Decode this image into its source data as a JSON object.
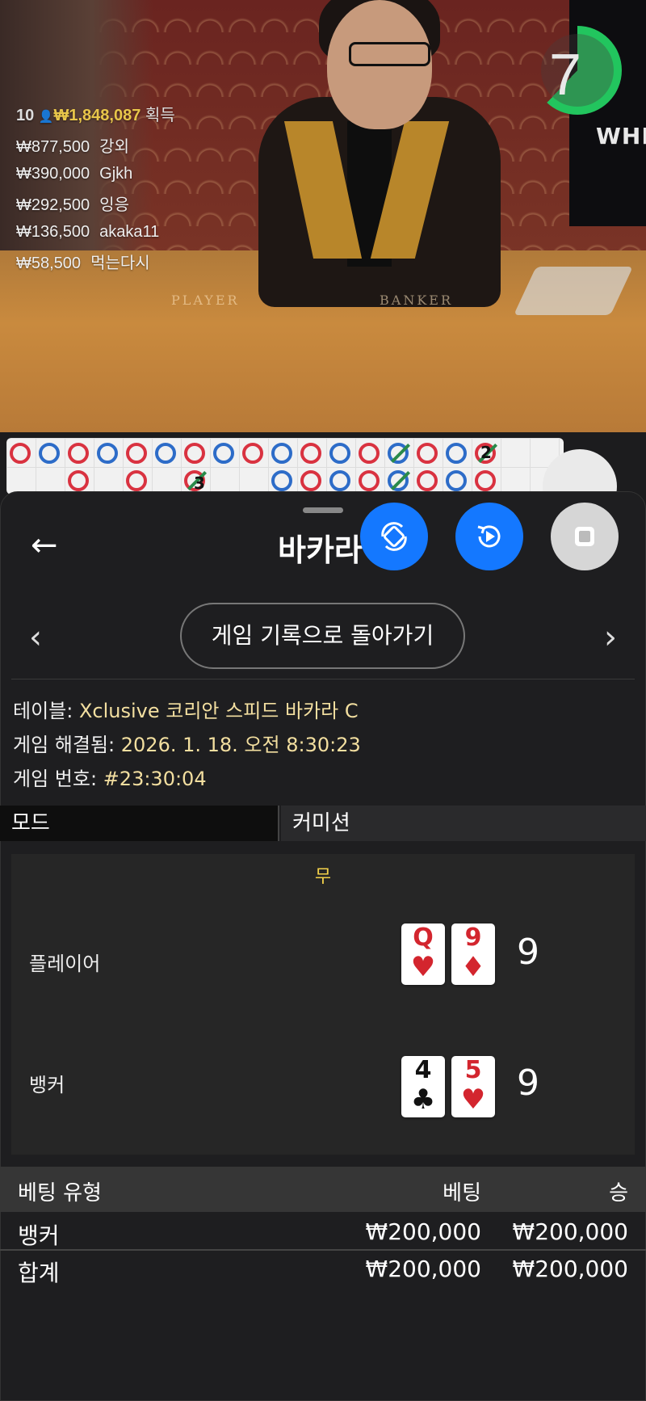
{
  "video": {
    "table_labels": [
      "PLAYER",
      "BANKER"
    ],
    "screen_text": "WHITE"
  },
  "timer": {
    "seconds": "7",
    "progress": 0.62,
    "color": "#22c55e"
  },
  "winners": {
    "count": "10",
    "total": "₩1,848,087",
    "total_label": "획득",
    "list": [
      {
        "amount": "₩877,500",
        "name": "강외"
      },
      {
        "amount": "₩390,000",
        "name": "Gjkh"
      },
      {
        "amount": "₩292,500",
        "name": "잉응"
      },
      {
        "amount": "₩136,500",
        "name": "akaka11"
      },
      {
        "amount": "₩58,500",
        "name": "먹는다시"
      }
    ]
  },
  "road": {
    "colors": {
      "banker": "#d93240",
      "player": "#2d6cc8",
      "tie": "#2a8a4a"
    },
    "numbers": [
      "3",
      "2"
    ]
  },
  "panel": {
    "title": "바카라",
    "back_icon": "arrow-left-icon",
    "buttons": [
      "rotate-icon",
      "replay-icon",
      "stop-icon"
    ],
    "return_label": "게임 기록으로 돌아가기"
  },
  "info": {
    "table_label": "테이블:",
    "table_value": "Xclusive 코리안 스피드 바카라 C",
    "resolved_label": "게임 해결됨:",
    "resolved_value": "2026. 1. 18. 오전 8:30:23",
    "number_label": "게임 번호:",
    "number_value": "#23:30:04"
  },
  "tabs": {
    "mode": "모드",
    "commission": "커미션"
  },
  "result": {
    "outcome": "무",
    "player": {
      "label": "플레이어",
      "cards": [
        {
          "rank": "Q",
          "suit": "♥",
          "color": "red"
        },
        {
          "rank": "9",
          "suit": "♦",
          "color": "red"
        }
      ],
      "score": "9"
    },
    "banker": {
      "label": "뱅커",
      "cards": [
        {
          "rank": "4",
          "suit": "♣",
          "color": "black"
        },
        {
          "rank": "5",
          "suit": "♥",
          "color": "red"
        }
      ],
      "score": "9"
    }
  },
  "bets": {
    "headers": {
      "type": "베팅 유형",
      "bet": "베팅",
      "win": "승"
    },
    "rows": [
      {
        "type": "뱅커",
        "bet": "₩200,000",
        "win": "₩200,000"
      },
      {
        "type": "합계",
        "bet": "₩200,000",
        "win": "₩200,000"
      }
    ]
  }
}
